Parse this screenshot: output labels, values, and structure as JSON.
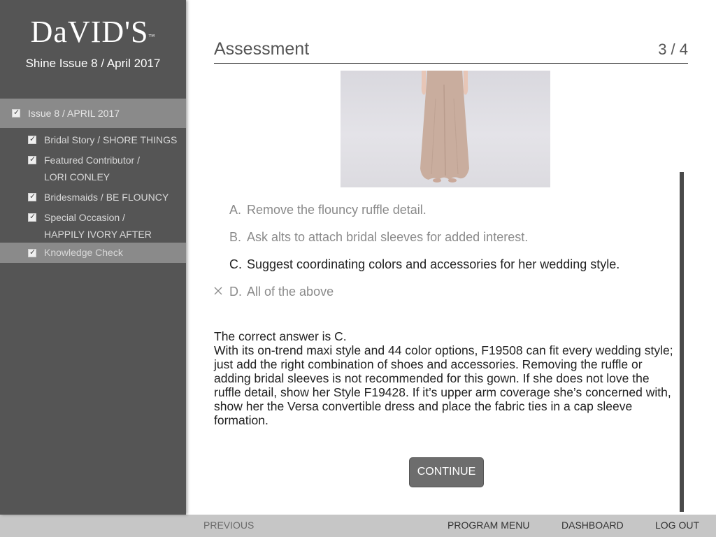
{
  "sidebar": {
    "logo_text": "DaVID'S",
    "logo_mark": "™",
    "issue_title": "Shine Issue 8 / April 2017",
    "top_item": "Issue 8 / APRIL 2017",
    "items": [
      {
        "lines": [
          "Bridal Story / SHORE THINGS"
        ]
      },
      {
        "lines": [
          "Featured Contributor /",
          "LORI CONLEY"
        ]
      },
      {
        "lines": [
          "Bridesmaids / BE FLOUNCY"
        ]
      },
      {
        "lines": [
          "Special Occasion /",
          "HAPPILY IVORY AFTER"
        ]
      },
      {
        "lines": [
          "Knowledge Check"
        ]
      }
    ]
  },
  "header": {
    "title": "Assessment",
    "counter": "3 / 4"
  },
  "answers": [
    {
      "letter": "A.",
      "text": "Remove the flouncy ruffle detail."
    },
    {
      "letter": "B.",
      "text": "Ask alts to attach bridal sleeves for added interest."
    },
    {
      "letter": "C.",
      "text": "Suggest coordinating colors and accessories for her wedding style."
    },
    {
      "letter": "D.",
      "text": "All of the above"
    }
  ],
  "feedback": {
    "headline": "The correct answer is C.",
    "body": "With its on-trend maxi style and 44 color options, F19508 can fit every wedding style; just add the right combination of shoes and accessories. Removing the ruffle or adding bridal sleeves is not recommended for this gown. If she does not love the ruffle detail, show her Style F19428. If it’s upper arm coverage she’s concerned with, show her the Versa convertible dress and place the fabric ties in a cap sleeve formation."
  },
  "continue_label": "CONTINUE",
  "footer": {
    "previous": "PREVIOUS",
    "program_menu": "PROGRAM MENU",
    "dashboard": "DASHBOARD",
    "logout": "LOG OUT"
  },
  "colors": {
    "sidebar_bg": "#555555",
    "sidebar_active": "#8a8a8a",
    "footer_bg": "#c6c6c6",
    "button_bg": "#6d6d6d"
  }
}
